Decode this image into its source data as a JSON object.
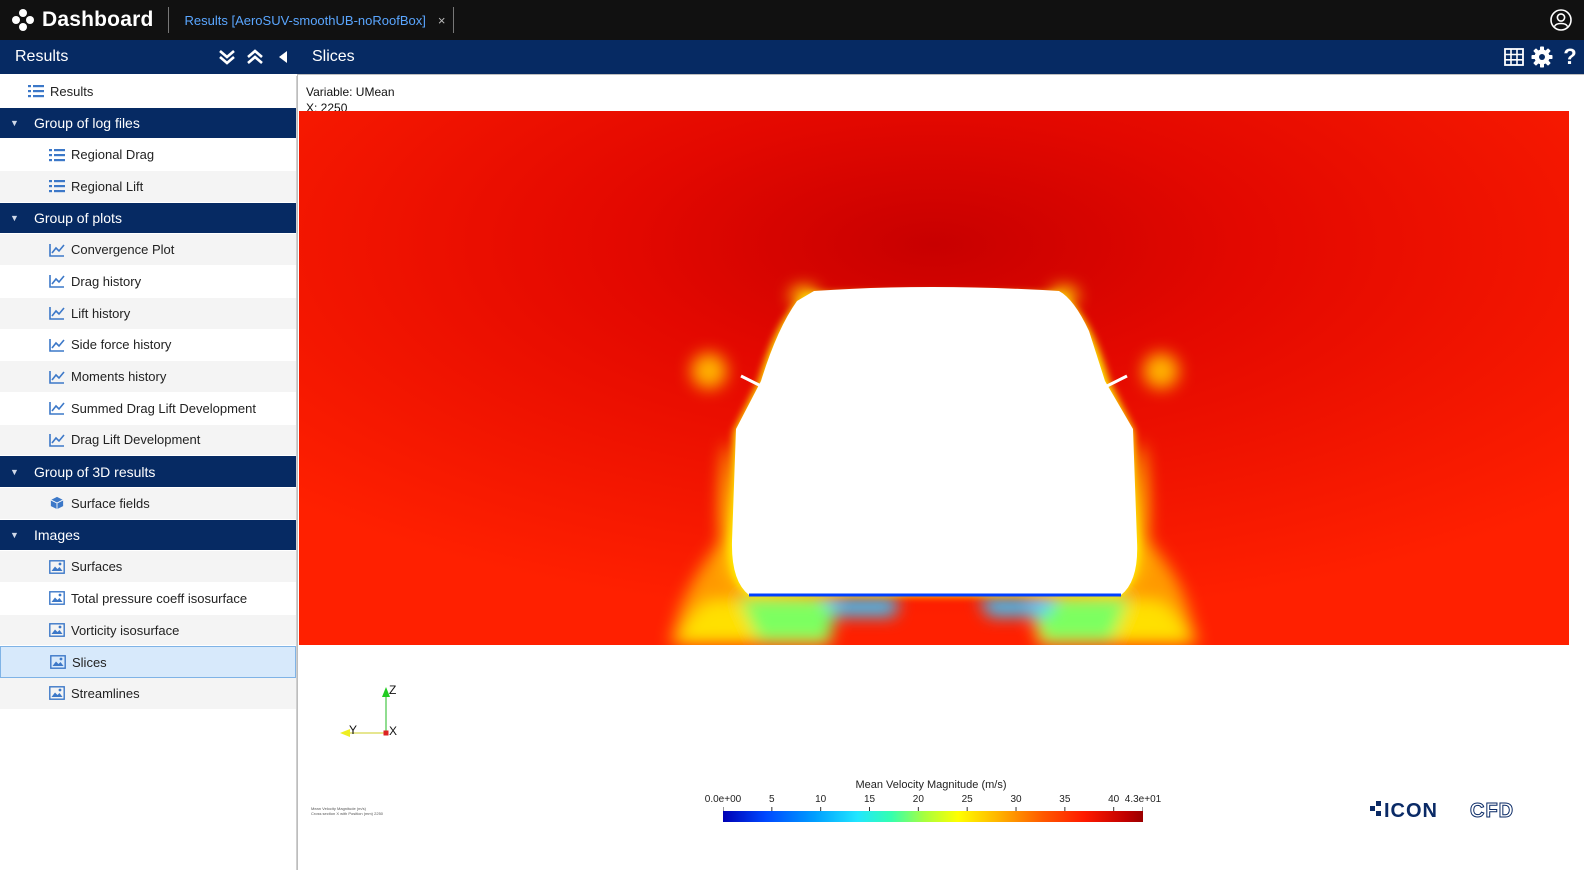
{
  "app": {
    "title": "Dashboard",
    "tab_label": "Results [AeroSUV-smoothUB-noRoofBox]",
    "tab_close": "×"
  },
  "left_panel": {
    "title": "Results"
  },
  "right_panel": {
    "title": "Slices"
  },
  "sidebar": {
    "root": "Results",
    "groups": [
      {
        "label": "Group of log files",
        "items": [
          "Regional Drag",
          "Regional Lift"
        ],
        "icon": "list-icon"
      },
      {
        "label": "Group of plots",
        "items": [
          "Convergence Plot",
          "Drag history",
          "Lift history",
          "Side force history",
          "Moments history",
          "Summed Drag Lift Development",
          "Drag Lift Development"
        ],
        "icon": "line-chart-icon"
      },
      {
        "label": "Group of 3D results",
        "items": [
          "Surface fields"
        ],
        "icon": "cube-icon"
      },
      {
        "label": "Images",
        "items": [
          "Surfaces",
          "Total pressure coeff isosurface",
          "Vorticity isosurface",
          "Slices",
          "Streamlines"
        ],
        "icon": "image-icon"
      }
    ],
    "selected": "Slices"
  },
  "viewer": {
    "variable_line": "Variable: UMean",
    "position_line": "X: 2250",
    "axes": {
      "z": "Z",
      "y": "Y",
      "x": "X"
    },
    "caption_line1": "Mean Velocity Magnitude (m/s)",
    "caption_line2": "Cross section X with Position (mm) 2250",
    "colorbar": {
      "title": "Mean Velocity Magnitude (m/s)",
      "labels": [
        "0.0e+00",
        "5",
        "10",
        "15",
        "20",
        "25",
        "30",
        "35",
        "40",
        "4.3e+01"
      ],
      "values": [
        0,
        5,
        10,
        15,
        20,
        25,
        30,
        35,
        40,
        43
      ],
      "min": 0,
      "max": 43
    },
    "logo": "ICONCFD"
  },
  "colors": {
    "topbar": "#111111",
    "header": "#062a63",
    "accent_link": "#5aa6ff",
    "selected_row": "#d7e9fb",
    "field_red": "#ff1a00"
  }
}
